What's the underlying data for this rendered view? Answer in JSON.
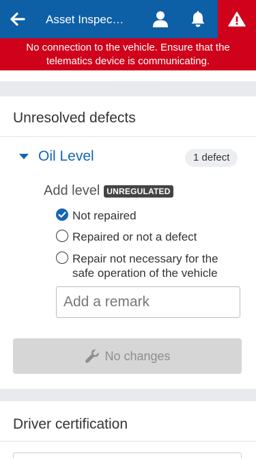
{
  "header": {
    "title": "Asset Inspec…",
    "icons": [
      "back-arrow-icon",
      "user-icon",
      "bell-icon",
      "warning-icon"
    ],
    "colors": {
      "bar": "#0d5fa6",
      "alert": "#d0021b"
    }
  },
  "banner": {
    "line1": "No connection to the vehicle. Ensure that the",
    "line2": "telematics device is communicating."
  },
  "defects": {
    "section_title": "Unresolved defects",
    "item": {
      "name": "Oil Level",
      "badge": "1 defect",
      "level_label": "Add level",
      "regulation_badge": "UNREGULATED",
      "options": [
        {
          "line1": "Not repaired",
          "line2": "",
          "selected": true
        },
        {
          "line1": "Repaired or not a defect",
          "line2": "",
          "selected": false
        },
        {
          "line1": "Repair not necessary for the",
          "line2": "safe operation of the vehicle",
          "selected": false
        }
      ],
      "remark_placeholder": "Add a remark",
      "remark_value": ""
    },
    "button_label": "No changes",
    "button_icon": "wrench-icon"
  },
  "certification": {
    "section_title": "Driver certification"
  }
}
